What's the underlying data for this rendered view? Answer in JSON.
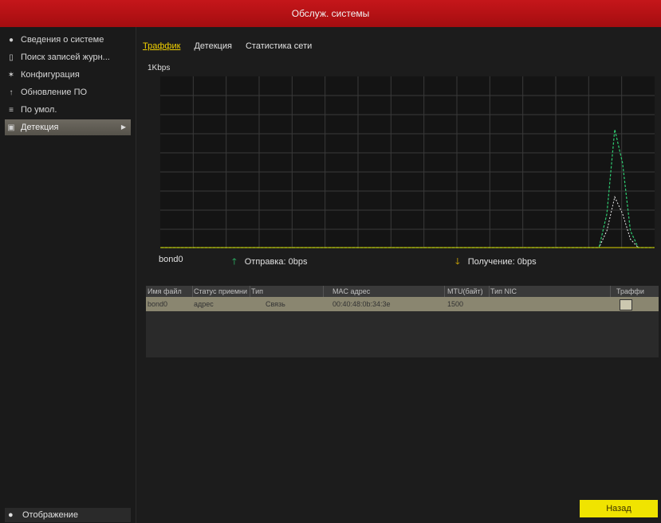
{
  "window": {
    "title": "Обслуж. системы"
  },
  "sidebar": {
    "items": [
      {
        "label": "Сведения о системе",
        "icon": "info-icon"
      },
      {
        "label": "Поиск записей журн...",
        "icon": "log-search-icon"
      },
      {
        "label": "Конфигурация",
        "icon": "config-icon"
      },
      {
        "label": "Обновление ПО",
        "icon": "upgrade-icon"
      },
      {
        "label": "По умол.",
        "icon": "default-icon"
      },
      {
        "label": "Детекция",
        "icon": "net-detect-icon"
      }
    ],
    "active_index": 5,
    "bottom_label": "Отображение"
  },
  "tabs": [
    "Траффик",
    "Детекция",
    "Статистика сети"
  ],
  "active_tab": 0,
  "chart_data": {
    "type": "line",
    "unit_label": "1Kbps",
    "grid": true,
    "series": [
      {
        "name": "Отправка",
        "color": "#2ecc71",
        "values": [
          0,
          0,
          0,
          0,
          0,
          0,
          0,
          0,
          0,
          0,
          0,
          0,
          0,
          0,
          0,
          0,
          0,
          0,
          0,
          0,
          0,
          0,
          0,
          0,
          0,
          0,
          0,
          0,
          0,
          0,
          0,
          0,
          0,
          0,
          0,
          0,
          0,
          0,
          0,
          0,
          0,
          0,
          0,
          0,
          0,
          0,
          0,
          0,
          0,
          0,
          0,
          0,
          0,
          0,
          0,
          0,
          0,
          0.2,
          0.7,
          0.5,
          0.1,
          0,
          0,
          0
        ]
      },
      {
        "name": "Получение",
        "color": "#f0f0f0",
        "values": [
          0,
          0,
          0,
          0,
          0,
          0,
          0,
          0,
          0,
          0,
          0,
          0,
          0,
          0,
          0,
          0,
          0,
          0,
          0,
          0,
          0,
          0,
          0,
          0,
          0,
          0,
          0,
          0,
          0,
          0,
          0,
          0,
          0,
          0,
          0,
          0,
          0,
          0,
          0,
          0,
          0,
          0,
          0,
          0,
          0,
          0,
          0,
          0,
          0,
          0,
          0,
          0,
          0,
          0,
          0,
          0,
          0,
          0.1,
          0.3,
          0.2,
          0.05,
          0,
          0,
          0
        ]
      }
    ],
    "ylim": [
      0,
      1
    ]
  },
  "legend": {
    "interface": "bond0",
    "send_label": "Отправка: 0bps",
    "receive_label": "Получение: 0bps"
  },
  "table": {
    "headers": [
      "Имя файл",
      "Статус приемни",
      "Тип",
      "MAC адрес",
      "MTU(байт)",
      "Тип NIC",
      "Траффи"
    ],
    "rows": [
      [
        "bond0",
        "адрес",
        "Связь",
        "00:40:48:0b:34:3e",
        "1500",
        "",
        ""
      ]
    ]
  },
  "buttons": {
    "back": "Назад"
  },
  "colors": {
    "title_bar": "#b31217",
    "accent": "#f0e400",
    "active_tab": "#f0d000"
  }
}
